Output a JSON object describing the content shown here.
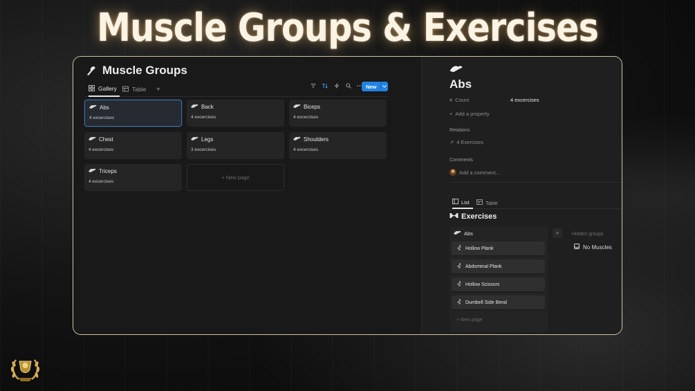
{
  "hero": {
    "title": "Muscle Groups & Exercises"
  },
  "left": {
    "title": "Muscle Groups",
    "tabs": [
      {
        "label": "Gallery",
        "icon": "gallery-icon",
        "active": true
      },
      {
        "label": "Table",
        "icon": "table-icon",
        "active": false
      }
    ],
    "add_view": "+",
    "toolbar": [
      "filter-icon",
      "sort-icon",
      "lightning-icon",
      "search-icon",
      "more-icon"
    ],
    "new_label": "New",
    "cards": [
      {
        "name": "Abs",
        "count": "4 excercises",
        "selected": true
      },
      {
        "name": "Back",
        "count": "4 excercises"
      },
      {
        "name": "Biceps",
        "count": "4 excercises"
      },
      {
        "name": "Chest",
        "count": "4 excercises"
      },
      {
        "name": "Legs",
        "count": "3 excercises"
      },
      {
        "name": "Shoulders",
        "count": "4 excercises"
      },
      {
        "name": "Triceps",
        "count": "4 excercises"
      }
    ],
    "new_page": "+ New page"
  },
  "right": {
    "title": "Abs",
    "count_label": "Count",
    "count_value": "4 excercises",
    "add_property": "Add a property",
    "relations_label": "Relations",
    "relations_value": "4 Exercises",
    "comments_label": "Comments",
    "comment_placeholder": "Add a comment...",
    "subtabs": [
      {
        "label": "List",
        "icon": "list-icon",
        "active": true
      },
      {
        "label": "Table",
        "icon": "table-icon",
        "active": false
      }
    ],
    "exercises_title": "Exercises",
    "group_name": "Abs",
    "exercises": [
      "Hollow Plank",
      "Abdominal Plank",
      "Hollow Scissors",
      "Dumbell Side Bend"
    ],
    "new_page": "+ New page",
    "add_group": "+",
    "hidden_groups": "Hidden groups",
    "no_muscles": "No Muscles"
  },
  "colors": {
    "accent": "#2383e2",
    "frame": "#cfc4a8"
  }
}
